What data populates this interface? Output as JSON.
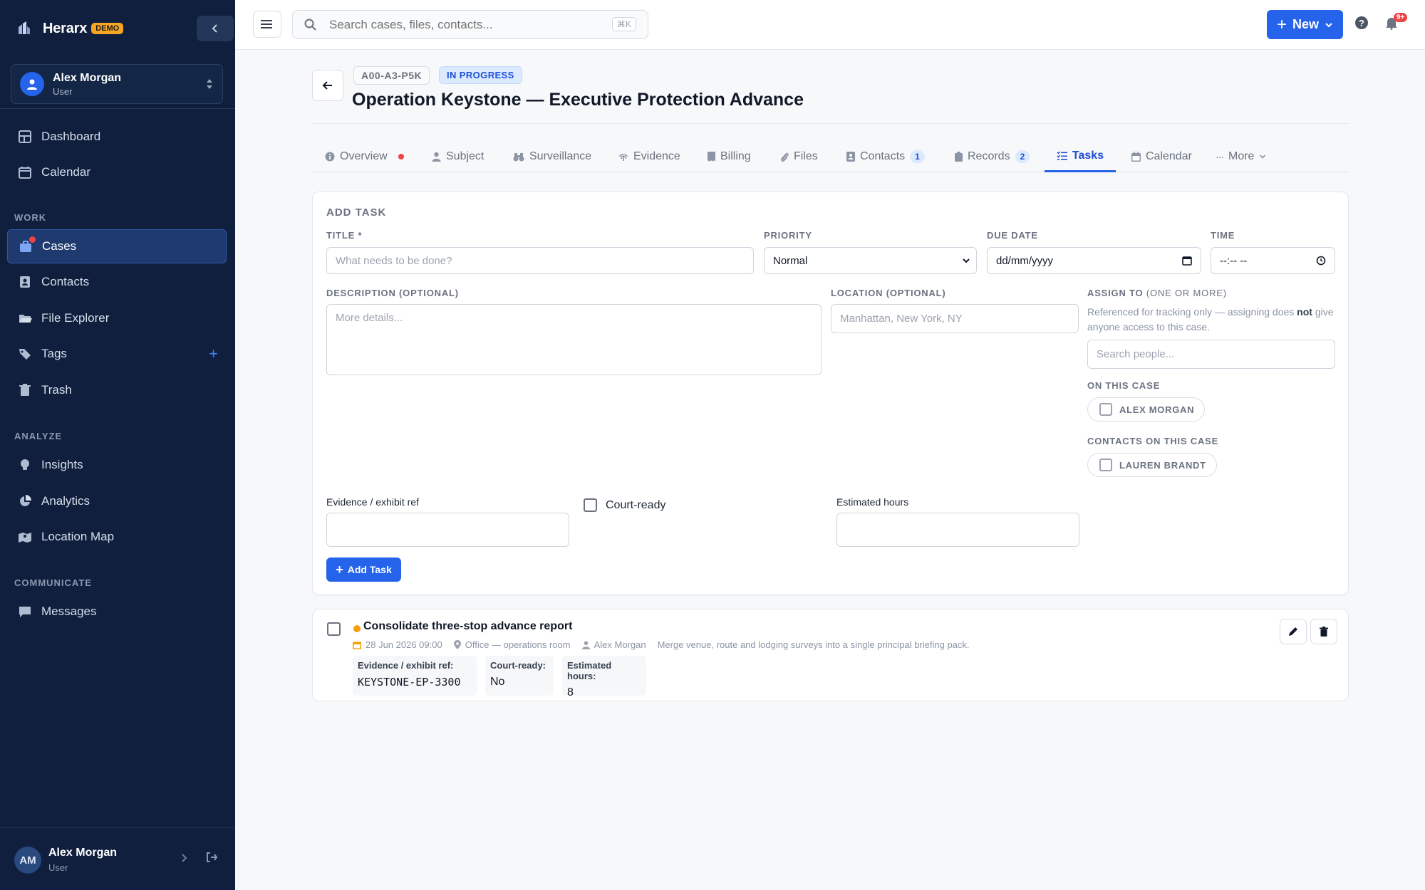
{
  "brand": {
    "name": "Herarx",
    "badge": "DEMO"
  },
  "account": {
    "name": "Alex Morgan",
    "role": "User"
  },
  "nav": {
    "dashboard": "Dashboard",
    "calendar": "Calendar",
    "work_label": "WORK",
    "cases": "Cases",
    "contacts": "Contacts",
    "file_explorer": "File Explorer",
    "tags": "Tags",
    "trash": "Trash",
    "analyze_label": "ANALYZE",
    "insights": "Insights",
    "analytics": "Analytics",
    "location_map": "Location Map",
    "communicate_label": "COMMUNICATE",
    "messages": "Messages"
  },
  "footer_user": {
    "initials": "AM",
    "name": "Alex Morgan",
    "role": "User"
  },
  "topbar": {
    "search_placeholder": "Search cases, files, contacts...",
    "shortcut": "⌘K",
    "new_label": "New",
    "notif_count": "9+"
  },
  "case": {
    "id": "A00-A3-P5K",
    "status": "IN PROGRESS",
    "title": "Operation Keystone — Executive Protection Advance"
  },
  "tabs": {
    "overview": "Overview",
    "subject": "Subject",
    "surveillance": "Surveillance",
    "evidence": "Evidence",
    "billing": "Billing",
    "files": "Files",
    "contacts": "Contacts",
    "contacts_count": "1",
    "records": "Records",
    "records_count": "2",
    "tasks": "Tasks",
    "calendar": "Calendar",
    "more": "More"
  },
  "form": {
    "heading": "ADD TASK",
    "title_label": "TITLE *",
    "title_placeholder": "What needs to be done?",
    "priority_label": "PRIORITY",
    "priority_value": "Normal",
    "due_label": "DUE DATE",
    "due_placeholder": "dd/mm/yyyy",
    "time_label": "TIME",
    "time_placeholder": "--:-- --",
    "desc_label": "DESCRIPTION (OPTIONAL)",
    "desc_placeholder": "More details...",
    "location_label": "LOCATION (OPTIONAL)",
    "location_placeholder": "Manhattan, New York, NY",
    "assign_label": "ASSIGN TO",
    "assign_suffix": "(ONE OR MORE)",
    "assign_help_1": "Referenced for tracking only — assigning does ",
    "assign_help_bold": "not",
    "assign_help_2": "give anyone access to this case.",
    "people_placeholder": "Search people...",
    "on_case_label": "ON THIS CASE",
    "on_case_person": "ALEX MORGAN",
    "contacts_label": "CONTACTS ON THIS CASE",
    "contact_person": "LAUREN BRANDT",
    "evidence_label": "Evidence / exhibit ref",
    "court_label": "Court-ready",
    "hours_label": "Estimated hours",
    "add_button": "Add Task"
  },
  "task": {
    "title": "Consolidate three-stop advance report",
    "date": "28 Jun 2026 09:00",
    "location": "Office — operations room",
    "assignee": "Alex Morgan",
    "description": "Merge venue, route and lodging surveys into a single principal briefing pack.",
    "evidence_label": "Evidence / exhibit ref:",
    "evidence_value": "KEYSTONE-EP-3300",
    "court_label": "Court-ready:",
    "court_value": "No",
    "hours_label": "Estimated hours:",
    "hours_value": "8"
  },
  "colors": {
    "sidebar": "#0f1f3d",
    "accent": "#2563eb",
    "priority": "#f59e0b",
    "alert": "#ef4444"
  }
}
